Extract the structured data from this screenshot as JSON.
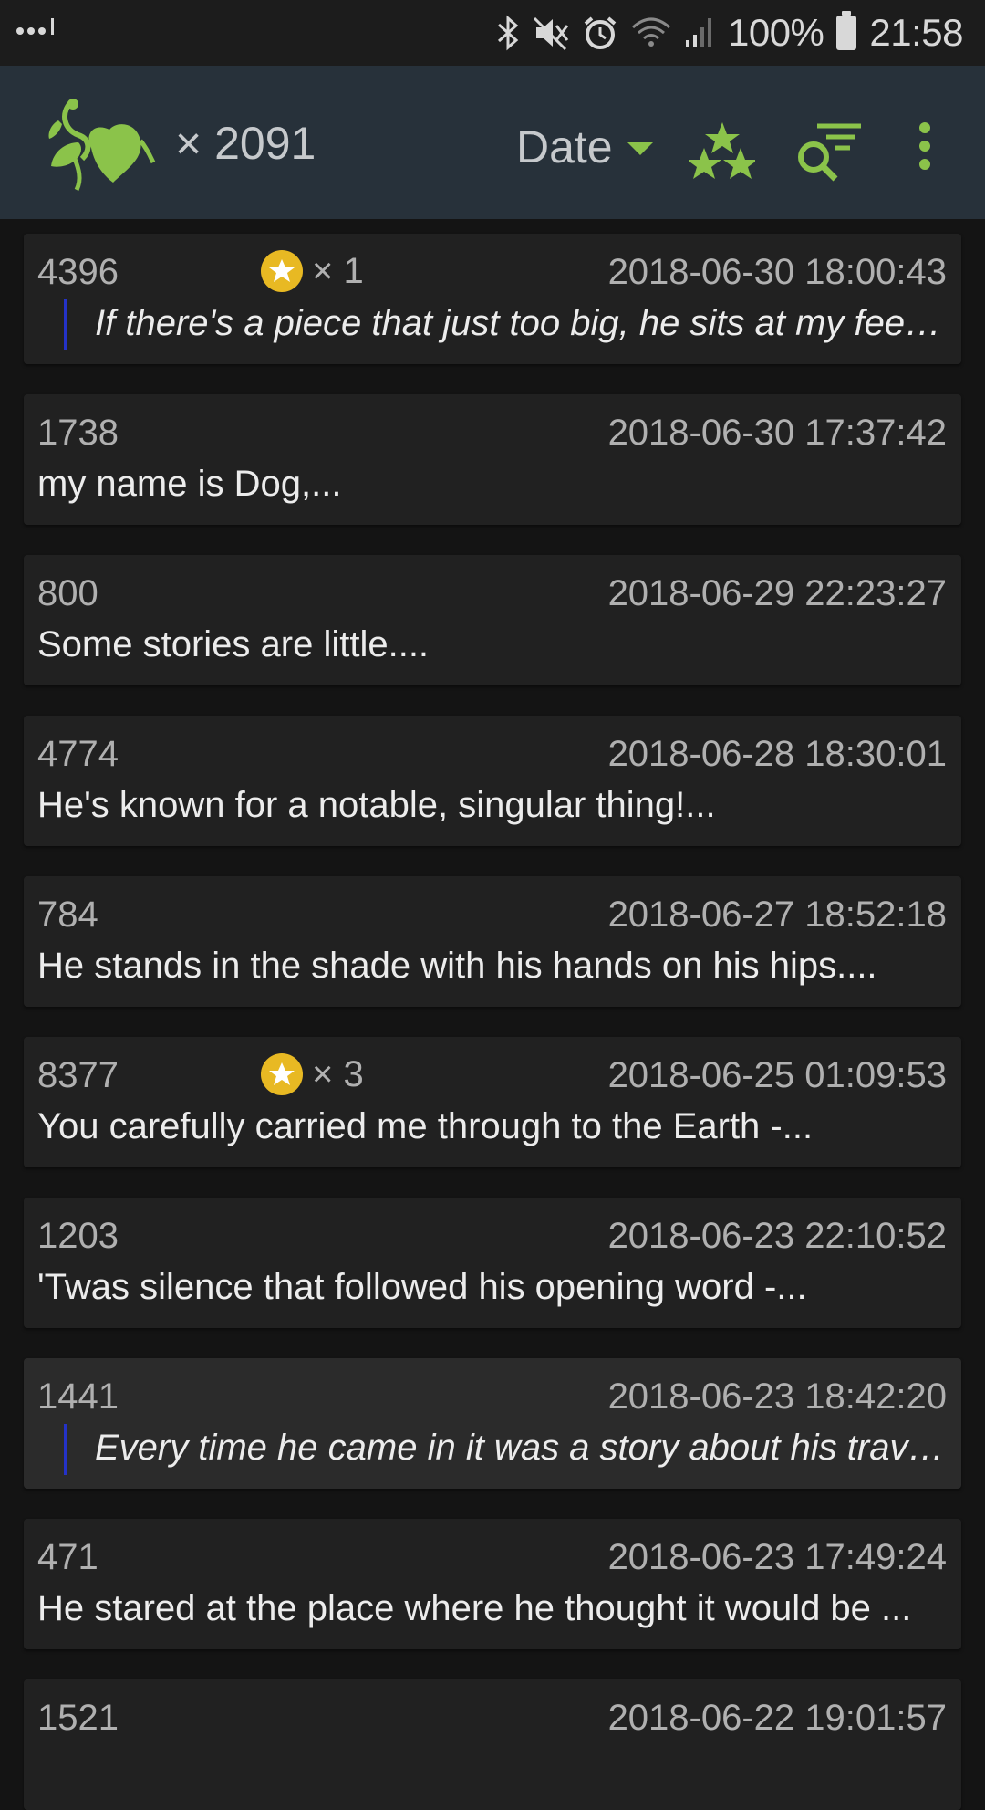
{
  "status": {
    "battery": "100%",
    "time": "21:58"
  },
  "toolbar": {
    "count": "× 2091",
    "sort_label": "Date",
    "accent": "#8bc34a",
    "icons": [
      "app-logo-icon",
      "favorites-stars-icon",
      "filter-search-icon",
      "overflow-menu-icon"
    ]
  },
  "entries": [
    {
      "id": "4396",
      "stars": "× 1",
      "date": "2018-06-30 18:00:43",
      "text": "If there's a piece that just too big, he sits at my feet...",
      "quote": true
    },
    {
      "id": "1738",
      "stars": "",
      "date": "2018-06-30 17:37:42",
      "text": "my name is Dog,...",
      "quote": false
    },
    {
      "id": "800",
      "stars": "",
      "date": "2018-06-29 22:23:27",
      "text": "Some stories are little....",
      "quote": false
    },
    {
      "id": "4774",
      "stars": "",
      "date": "2018-06-28 18:30:01",
      "text": "He's known for a notable, singular thing!...",
      "quote": false
    },
    {
      "id": "784",
      "stars": "",
      "date": "2018-06-27 18:52:18",
      "text": "He stands in the shade with his hands on his hips....",
      "quote": false
    },
    {
      "id": "8377",
      "stars": "× 3",
      "date": "2018-06-25 01:09:53",
      "text": "You carefully carried me through to the Earth -...",
      "quote": false
    },
    {
      "id": "1203",
      "stars": "",
      "date": "2018-06-23 22:10:52",
      "text": "'Twas silence that followed his opening word -...",
      "quote": false
    },
    {
      "id": "1441",
      "stars": "",
      "date": "2018-06-23 18:42:20",
      "text": "Every time he came in it was a story about his travels...",
      "quote": true,
      "highlight": true
    },
    {
      "id": "471",
      "stars": "",
      "date": "2018-06-23 17:49:24",
      "text": "He stared at the place where he thought it would be ...",
      "quote": false
    },
    {
      "id": "1521",
      "stars": "",
      "date": "2018-06-22 19:01:57",
      "text": "",
      "quote": false
    }
  ]
}
